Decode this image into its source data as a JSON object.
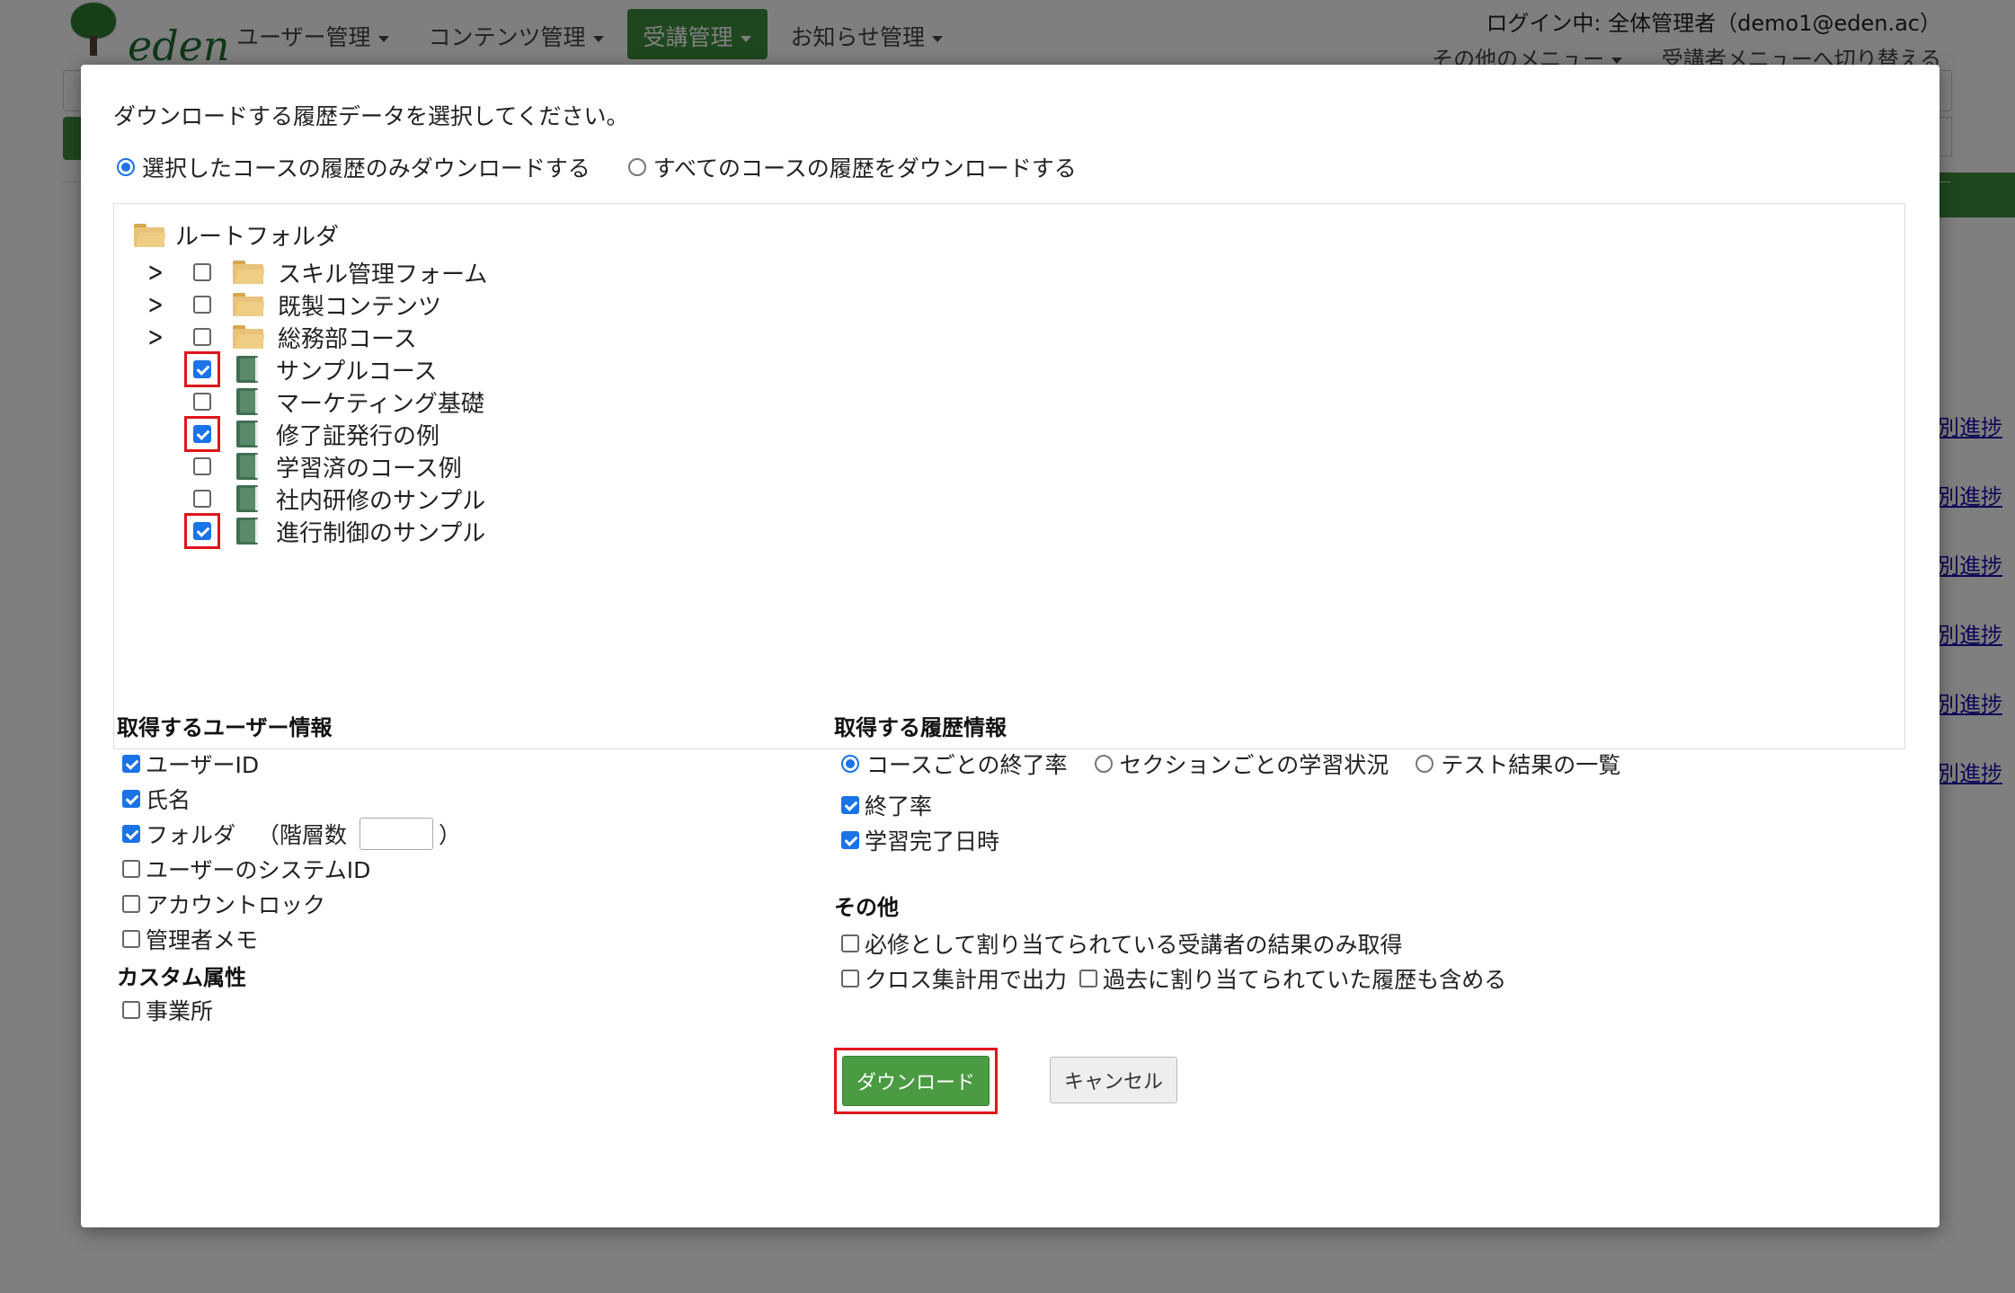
{
  "app": {
    "logo_text": "eden",
    "nav": [
      {
        "label": "ユーザー管理"
      },
      {
        "label": "コンテンツ管理"
      },
      {
        "label": "受講管理"
      },
      {
        "label": "お知らせ管理"
      }
    ],
    "login_text": "ログイン中: 全体管理者（demo1@eden.ac）",
    "menu_other": "その他のメニュー",
    "menu_switch": "受講者メニューへ切り替える",
    "side_link": "別進捗"
  },
  "modal": {
    "intro": "ダウンロードする履歴データを選択してください。",
    "scope": {
      "selected_label": "選択したコースの履歴のみダウンロードする",
      "all_label": "すべてのコースの履歴をダウンロードする",
      "value": "selected"
    },
    "tree": {
      "root_label": "ルートフォルダ",
      "items": [
        {
          "type": "folder",
          "label": "スキル管理フォーム",
          "checked": false
        },
        {
          "type": "folder",
          "label": "既製コンテンツ",
          "checked": false
        },
        {
          "type": "folder",
          "label": "総務部コース",
          "checked": false
        },
        {
          "type": "course",
          "label": "サンプルコース",
          "checked": true
        },
        {
          "type": "course",
          "label": "マーケティング基礎",
          "checked": false
        },
        {
          "type": "course",
          "label": "修了証発行の例",
          "checked": true
        },
        {
          "type": "course",
          "label": "学習済のコース例",
          "checked": false
        },
        {
          "type": "course",
          "label": "社内研修のサンプル",
          "checked": false
        },
        {
          "type": "course",
          "label": "進行制御のサンプル",
          "checked": true
        }
      ]
    },
    "user_info": {
      "heading": "取得するユーザー情報",
      "user_id": "ユーザーID",
      "name": "氏名",
      "folder": "フォルダ",
      "depth_label": "（階層数",
      "depth_close": "）",
      "depth_value": "",
      "system_id": "ユーザーのシステムID",
      "account_lock": "アカウントロック",
      "admin_memo": "管理者メモ"
    },
    "custom": {
      "heading": "カスタム属性",
      "office": "事業所"
    },
    "history": {
      "heading": "取得する履歴情報",
      "per_course": "コースごとの終了率",
      "per_section": "セクションごとの学習状況",
      "test_results": "テスト結果の一覧",
      "completion_rate": "終了率",
      "completion_time": "学習完了日時"
    },
    "other": {
      "heading": "その他",
      "required_only": "必修として割り当てられている受講者の結果のみ取得",
      "cross_tab": "クロス集計用で出力",
      "include_past": "過去に割り当てられていた履歴も含める"
    },
    "download_label": "ダウンロード",
    "cancel_label": "キャンセル"
  }
}
